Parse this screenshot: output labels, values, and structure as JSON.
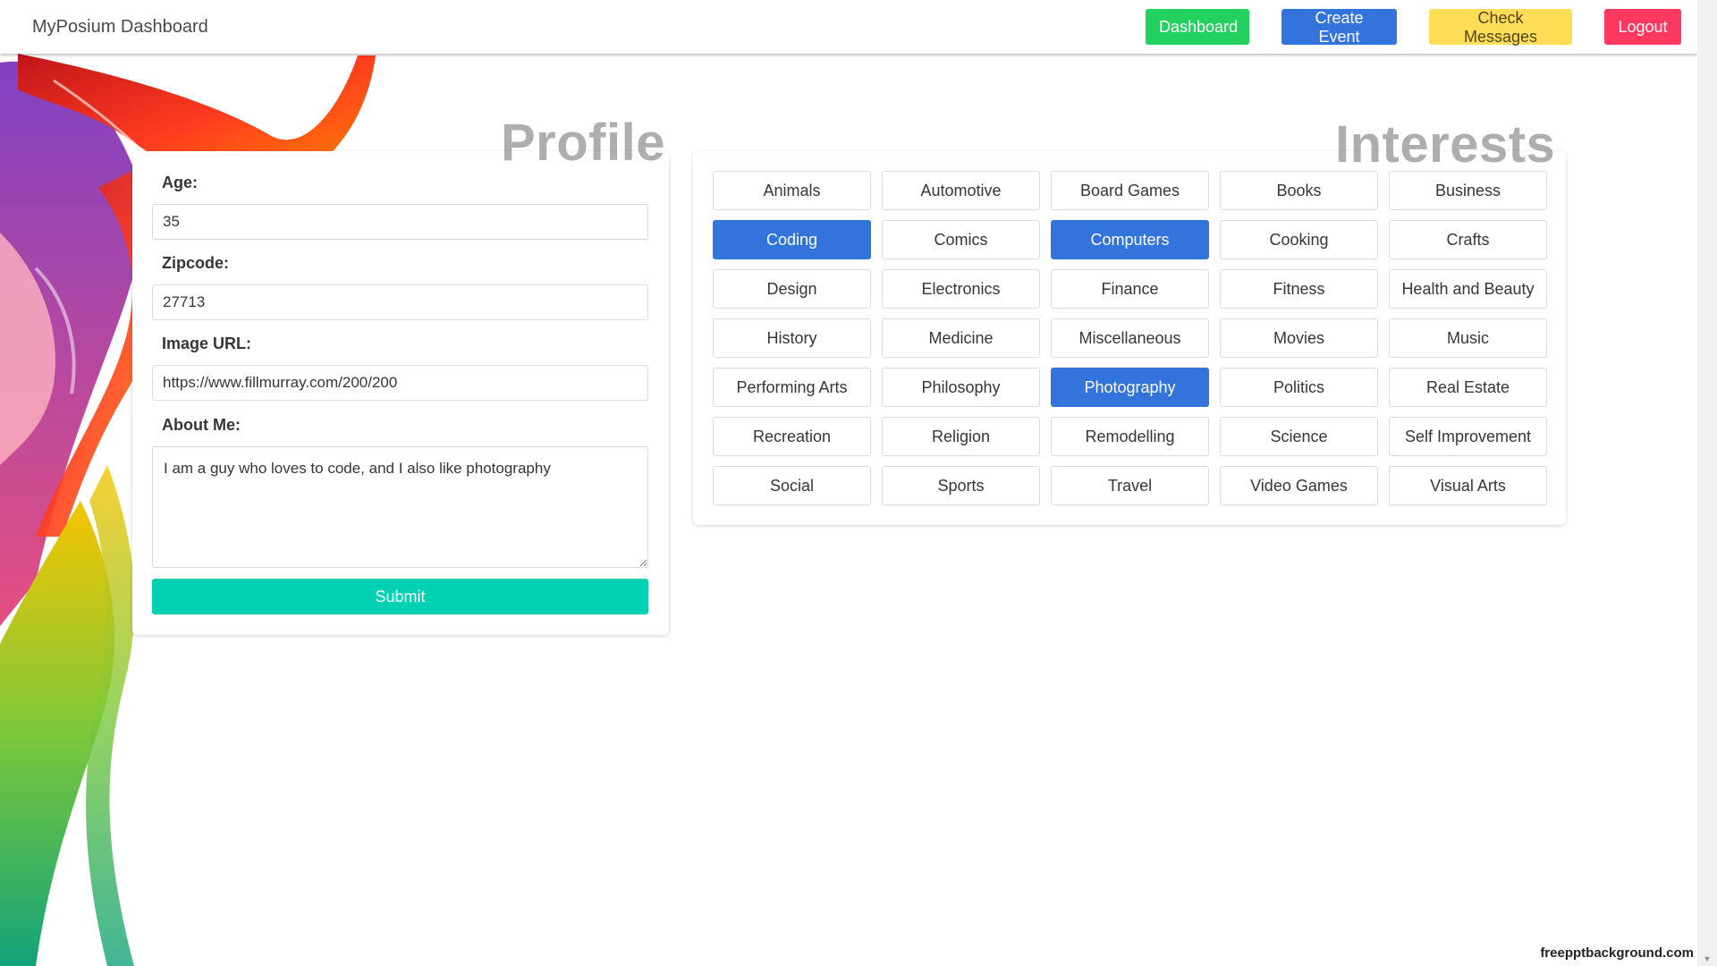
{
  "colors": {
    "dashboard_btn": "#23d160",
    "create_event_btn": "#3273dc",
    "check_messages_btn": "#ffdd57",
    "logout_btn": "#ff3860",
    "submit_btn": "#00d1b2",
    "selected_interest": "#3273dc"
  },
  "navbar": {
    "brand": "MyPosium Dashboard",
    "dashboard_label": "Dashboard",
    "create_event_label": "Create Event",
    "check_messages_label": "Check Messages",
    "logout_label": "Logout"
  },
  "profile": {
    "title": "Profile",
    "age_label": "Age:",
    "age_value": "35",
    "zipcode_label": "Zipcode:",
    "zipcode_value": "27713",
    "image_url_label": "Image URL:",
    "image_url_value": "https://www.fillmurray.com/200/200",
    "about_label": "About Me:",
    "about_value": "I am a guy who loves to code, and I also like photography",
    "submit_label": "Submit"
  },
  "interests": {
    "title": "Interests",
    "items": [
      {
        "label": "Animals",
        "selected": false
      },
      {
        "label": "Automotive",
        "selected": false
      },
      {
        "label": "Board Games",
        "selected": false
      },
      {
        "label": "Books",
        "selected": false
      },
      {
        "label": "Business",
        "selected": false
      },
      {
        "label": "Coding",
        "selected": true
      },
      {
        "label": "Comics",
        "selected": false
      },
      {
        "label": "Computers",
        "selected": true
      },
      {
        "label": "Cooking",
        "selected": false
      },
      {
        "label": "Crafts",
        "selected": false
      },
      {
        "label": "Design",
        "selected": false
      },
      {
        "label": "Electronics",
        "selected": false
      },
      {
        "label": "Finance",
        "selected": false
      },
      {
        "label": "Fitness",
        "selected": false
      },
      {
        "label": "Health and Beauty",
        "selected": false
      },
      {
        "label": "History",
        "selected": false
      },
      {
        "label": "Medicine",
        "selected": false
      },
      {
        "label": "Miscellaneous",
        "selected": false
      },
      {
        "label": "Movies",
        "selected": false
      },
      {
        "label": "Music",
        "selected": false
      },
      {
        "label": "Performing Arts",
        "selected": false
      },
      {
        "label": "Philosophy",
        "selected": false
      },
      {
        "label": "Photography",
        "selected": true
      },
      {
        "label": "Politics",
        "selected": false
      },
      {
        "label": "Real Estate",
        "selected": false
      },
      {
        "label": "Recreation",
        "selected": false
      },
      {
        "label": "Religion",
        "selected": false
      },
      {
        "label": "Remodelling",
        "selected": false
      },
      {
        "label": "Science",
        "selected": false
      },
      {
        "label": "Self Improvement",
        "selected": false
      },
      {
        "label": "Social",
        "selected": false
      },
      {
        "label": "Sports",
        "selected": false
      },
      {
        "label": "Travel",
        "selected": false
      },
      {
        "label": "Video Games",
        "selected": false
      },
      {
        "label": "Visual Arts",
        "selected": false
      }
    ]
  },
  "watermark": "freepptbackground.com"
}
